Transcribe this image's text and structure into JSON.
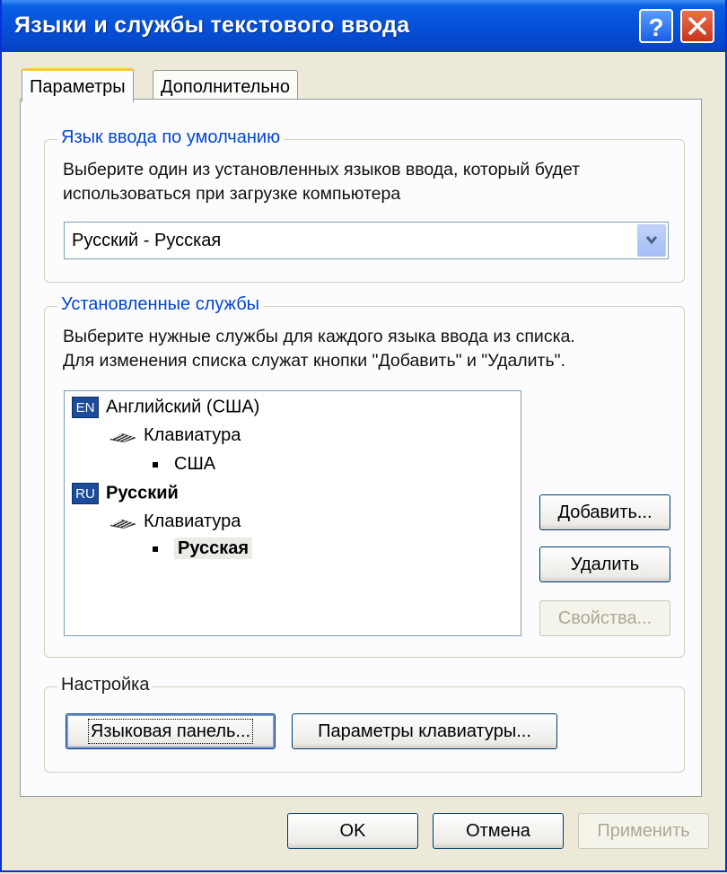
{
  "window": {
    "title": "Языки и службы текстового ввода",
    "help_label": "?",
    "close_label": "✕"
  },
  "tabs": [
    {
      "label": "Параметры",
      "active": true
    },
    {
      "label": "Дополнительно",
      "active": false
    }
  ],
  "default_lang": {
    "legend": "Язык ввода по умолчанию",
    "desc_line1": "Выберите один из установленных языков ввода, который будет",
    "desc_line2": "использоваться при загрузке компьютера",
    "selected": "Русский - Русская"
  },
  "services": {
    "legend": "Установленные службы",
    "desc_line1": "Выберите нужные службы для каждого языка ввода из списка.",
    "desc_line2": "Для изменения списка служат кнопки \"Добавить\" и \"Удалить\".",
    "tree": {
      "en_flag": "EN",
      "en_label": "Английский (США)",
      "en_kb": "Клавиатура",
      "en_layout": "США",
      "ru_flag": "RU",
      "ru_label": "Русский",
      "ru_kb": "Клавиатура",
      "ru_layout": "Русская"
    },
    "add_label": "Добавить...",
    "remove_label": "Удалить",
    "props_label": "Свойства..."
  },
  "settings": {
    "legend": "Настройка",
    "langbar_label": "Языковая панель...",
    "kbd_label": "Параметры клавиатуры..."
  },
  "footer": {
    "ok_label": "OK",
    "cancel_label": "Отмена",
    "apply_label": "Применить"
  },
  "colors": {
    "titlebar": "#0551d9",
    "group_legend": "#0046d5",
    "flag": "#1b4c9b"
  }
}
